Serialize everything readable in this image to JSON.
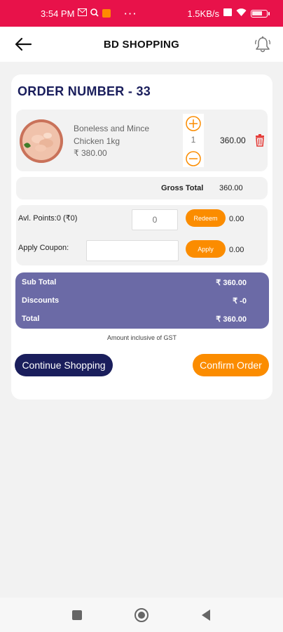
{
  "status_bar": {
    "time": "3:54 PM",
    "network_speed": "1.5KB/s",
    "icons": [
      "gmail-icon",
      "search-icon",
      "app-notification-icon",
      "more-dots-icon",
      "vowifi-icon",
      "wifi-icon",
      "battery-icon"
    ]
  },
  "header": {
    "title": "BD SHOPPING",
    "back_icon": "arrow-left-icon",
    "bell_icon": "bell-icon"
  },
  "order": {
    "title": "ORDER NUMBER - 33",
    "items": [
      {
        "name": "Boneless and Mince Chicken 1kg",
        "price": "₹ 380.00",
        "quantity": "1",
        "total": "360.00"
      }
    ],
    "gross_total_label": "Gross Total",
    "gross_total_value": "360.00"
  },
  "points": {
    "label": "Avl. Points:0 (₹0)",
    "input_placeholder": "0",
    "redeem_label": "Redeem",
    "value": "0.00"
  },
  "coupon": {
    "label": "Apply Coupon:",
    "input_value": "",
    "apply_label": "Apply",
    "value": "0.00"
  },
  "summary": {
    "rows": [
      {
        "label": "Sub Total",
        "value": "₹ 360.00"
      },
      {
        "label": "Discounts",
        "value": "₹ -0"
      },
      {
        "label": "Total",
        "value": "₹ 360.00"
      }
    ],
    "note": "Amount inclusive of GST"
  },
  "actions": {
    "continue_label": "Continue Shopping",
    "confirm_label": "Confirm Order"
  },
  "nav": {
    "icons": [
      "recent-apps-icon",
      "home-icon",
      "back-triangle-icon"
    ]
  },
  "colors": {
    "status_bar": "#e8124a",
    "navy": "#1a1e5c",
    "orange": "#fb8c00",
    "summary_bg": "#6b6aa6",
    "delete_red": "#e53935"
  }
}
